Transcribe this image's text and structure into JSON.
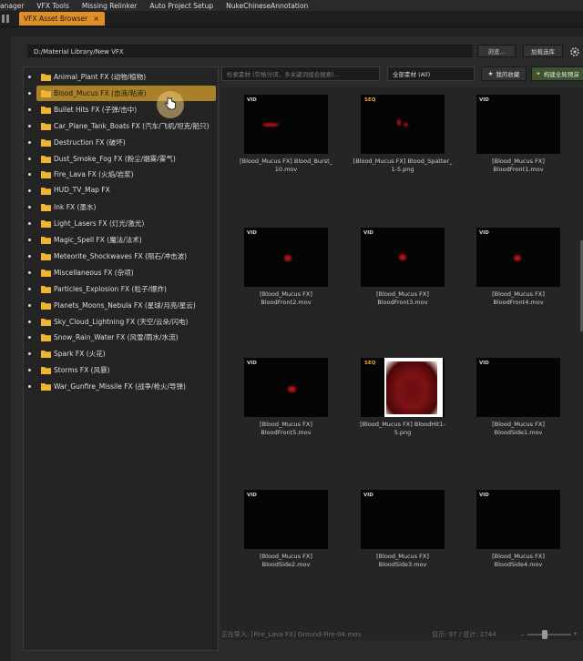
{
  "menubar": {
    "items": [
      "anager",
      "VFX Tools",
      "Missing Relinker",
      "Auto Project Setup",
      "NukeChineseAnnotation"
    ]
  },
  "tab": {
    "title": "VFX Asset Browser",
    "close": "×"
  },
  "toolbar": {
    "path_value": "D:/Material Library/New VFX",
    "browse_label": "浏览...",
    "add_library_label": "加载选库",
    "settings_icon": "gear-icon"
  },
  "sidebar": {
    "items": [
      {
        "label": "Animal_Plant FX (动物/植物)"
      },
      {
        "label": "Blood_Mucus FX (血液/粘液)"
      },
      {
        "label": "Bullet Hits FX (子弹/击中)"
      },
      {
        "label": "Car_Plane_Tank_Boats FX (汽车/飞机/坦克/船只)"
      },
      {
        "label": "Destruction FX (破坏)"
      },
      {
        "label": "Dust_Smoke_Fog FX (粉尘/烟雾/雾气)"
      },
      {
        "label": "Fire_Lava FX (火焰/岩浆)"
      },
      {
        "label": "HUD_TV_Map FX"
      },
      {
        "label": "Ink FX (墨水)"
      },
      {
        "label": "Light_Lasers FX (灯光/激光)"
      },
      {
        "label": "Magic_Spell FX (魔法/法术)"
      },
      {
        "label": "Meteorite_Shockwaves FX (陨石/冲击波)"
      },
      {
        "label": "Miscellaneous FX (杂项)"
      },
      {
        "label": "Particles_Explosion FX (粒子/爆炸)"
      },
      {
        "label": "Planets_Moons_Nebula FX (星球/月亮/星云)"
      },
      {
        "label": "Sky_Cloud_Lightning FX (天空/云朵/闪电)"
      },
      {
        "label": "Snow_Rain_Water FX (风雪/雨水/水流)"
      },
      {
        "label": "Spark FX (火花)"
      },
      {
        "label": "Storms FX (风暴)"
      },
      {
        "label": "War_Gunfire_Missile FX (战争/枪火/导弹)"
      }
    ],
    "selected_index": 1
  },
  "filters": {
    "search_placeholder": "检索素材 (空格分词，多关键词组合搜索)...",
    "type_select": "全部素材 (All)",
    "favorites_label": "我的收藏",
    "build_index_label": "构建全局预演"
  },
  "assets": [
    {
      "badge": "VID",
      "name": "[Blood_Mucus FX] Blood_Burst_\n10.mov"
    },
    {
      "badge": "SEQ",
      "name": "[Blood_Mucus FX] Blood_Spatter_\n1-5.png"
    },
    {
      "badge": "VID",
      "name": "[Blood_Mucus FX]\nBloodFront1.mov"
    },
    {
      "badge": "VID",
      "name": "[Blood_Mucus FX]\nBloodFront2.mov"
    },
    {
      "badge": "VID",
      "name": "[Blood_Mucus FX]\nBloodFront3.mov"
    },
    {
      "badge": "VID",
      "name": "[Blood_Mucus FX]\nBloodFront4.mov"
    },
    {
      "badge": "VID",
      "name": "[Blood_Mucus FX]\nBloodFront5.mov"
    },
    {
      "badge": "SEQ",
      "name": "[Blood_Mucus FX] BloodHit1-\n5.png"
    },
    {
      "badge": "VID",
      "name": "[Blood_Mucus FX]\nBloodSide1.mov"
    },
    {
      "badge": "VID",
      "name": "[Blood_Mucus FX]\nBloodSide2.mov"
    },
    {
      "badge": "VID",
      "name": "[Blood_Mucus FX]\nBloodSide3.mov"
    },
    {
      "badge": "VID",
      "name": "[Blood_Mucus FX]\nBloodSide4.mov"
    }
  ],
  "status": {
    "importing": "正在导入: [Fire_Lava FX] Ground-Fire-04.mov",
    "count": "显示: 97 / 总计: 2744"
  },
  "colors": {
    "accent": "#e08e26",
    "selected": "#c1922a",
    "build_btn": "#3c5432"
  }
}
